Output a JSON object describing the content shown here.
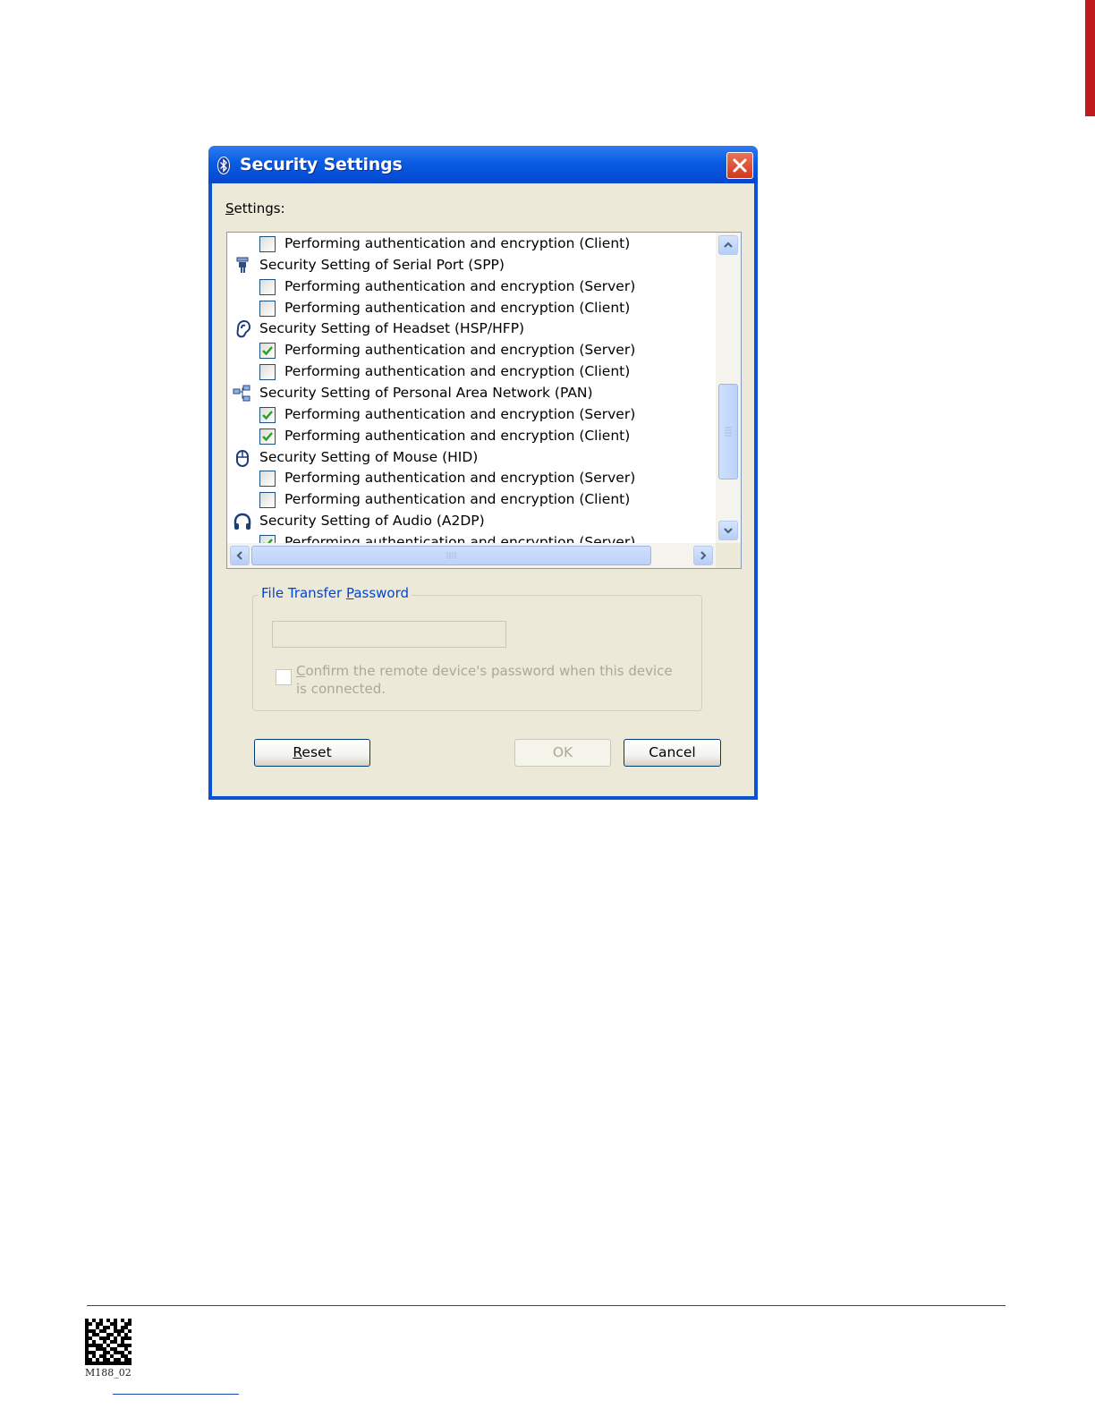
{
  "window": {
    "title": "Security Settings",
    "title_icon": "bluetooth-icon",
    "close_icon": "close-icon"
  },
  "settings_label": "Settings:",
  "list": {
    "rows": [
      {
        "kind": "item",
        "text": "Performing authentication and encryption (Client)",
        "checked": false
      },
      {
        "kind": "group",
        "text": "Security Setting of Serial Port (SPP)",
        "icon": "serial-port-icon"
      },
      {
        "kind": "item",
        "text": "Performing authentication and encryption (Server)",
        "checked": false
      },
      {
        "kind": "item",
        "text": "Performing authentication and encryption (Client)",
        "checked": false
      },
      {
        "kind": "group",
        "text": "Security Setting of Headset (HSP/HFP)",
        "icon": "ear-icon"
      },
      {
        "kind": "item",
        "text": "Performing authentication and encryption (Server)",
        "checked": true
      },
      {
        "kind": "item",
        "text": "Performing authentication and encryption (Client)",
        "checked": false
      },
      {
        "kind": "group",
        "text": "Security Setting of Personal Area Network (PAN)",
        "icon": "network-icon"
      },
      {
        "kind": "item",
        "text": "Performing authentication and encryption (Server)",
        "checked": true
      },
      {
        "kind": "item",
        "text": "Performing authentication and encryption (Client)",
        "checked": true
      },
      {
        "kind": "group",
        "text": "Security Setting of Mouse (HID)",
        "icon": "mouse-icon"
      },
      {
        "kind": "item",
        "text": "Performing authentication and encryption (Server)",
        "checked": false
      },
      {
        "kind": "item",
        "text": "Performing authentication and encryption (Client)",
        "checked": false
      },
      {
        "kind": "group",
        "text": "Security Setting of Audio (A2DP)",
        "icon": "headphones-icon"
      },
      {
        "kind": "item",
        "text": "Performing authentication and encryption (Server)",
        "checked": true
      }
    ]
  },
  "file_transfer": {
    "group_title": "File Transfer Password",
    "password_value": "",
    "confirm_label": "Confirm the remote device's password when this device is connected.",
    "confirm_checked": false
  },
  "buttons": {
    "reset": "Reset",
    "ok": "OK",
    "cancel": "Cancel"
  },
  "footer": {
    "matrix_label": "M188_02"
  },
  "colors": {
    "titlebar": "#0a5be3",
    "dialog_face": "#ece9d8",
    "check_mark": "#21a121",
    "group_title": "#0046d5",
    "page_tab": "#c01a1d"
  }
}
